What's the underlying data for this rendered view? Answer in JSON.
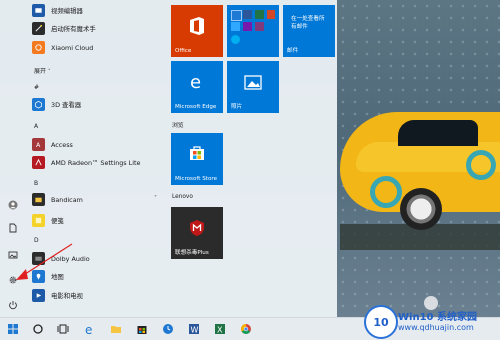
{
  "start_menu": {
    "apps_top": [
      {
        "label": "视频编辑器",
        "color": "#1e5aa8"
      },
      {
        "label": "启动所有魔术手",
        "color": "#2b2b2b"
      },
      {
        "label": "Xiaomi Cloud",
        "color": "#f47a20"
      }
    ],
    "expand_label": "展开",
    "sections": {
      "hash": "#",
      "a": "A",
      "b": "B",
      "d": "D"
    },
    "apps_hash": [
      {
        "label": "3D 查看器",
        "color": "#1e78d1"
      }
    ],
    "apps_a": [
      {
        "label": "Access",
        "color": "#a4373a"
      },
      {
        "label": "AMD Radeon™ Settings Lite",
        "color": "#b51a22"
      }
    ],
    "apps_b": [
      {
        "label": "Bandicam",
        "color": "#2c2c2c"
      },
      {
        "label": "便笺",
        "color": "#f5d22a"
      }
    ],
    "apps_d": [
      {
        "label": "Dolby Audio",
        "color": "#2c2c2c"
      },
      {
        "label": "地图",
        "color": "#1e78d1"
      },
      {
        "label": "电影和电视",
        "color": "#1e5aa8"
      }
    ]
  },
  "tiles": {
    "office_label": "Office",
    "mail_label": "邮件",
    "mail_subtitle": "在一处查看所有邮件",
    "edge_label": "Microsoft Edge",
    "photos_label": "照片",
    "group_browse": "浏览",
    "store_label": "Microsoft Store",
    "group_lenovo": "Lenovo",
    "mcafee_label": "联想杀毒Plus"
  },
  "colors": {
    "office": "#d83b01",
    "tile_blue": "#0078d7",
    "mcafee": "#2b2b2b"
  },
  "taskbar": {
    "icons": [
      "windows-icon",
      "cortana-icon",
      "task-view-icon",
      "edge-icon",
      "file-explorer-icon",
      "store-icon",
      "clock-icon",
      "word-icon",
      "excel-icon",
      "chrome-icon"
    ]
  },
  "watermark": {
    "title": "Win10 系统家园",
    "url": "www.qdhuajin.com",
    "badge": "10"
  }
}
